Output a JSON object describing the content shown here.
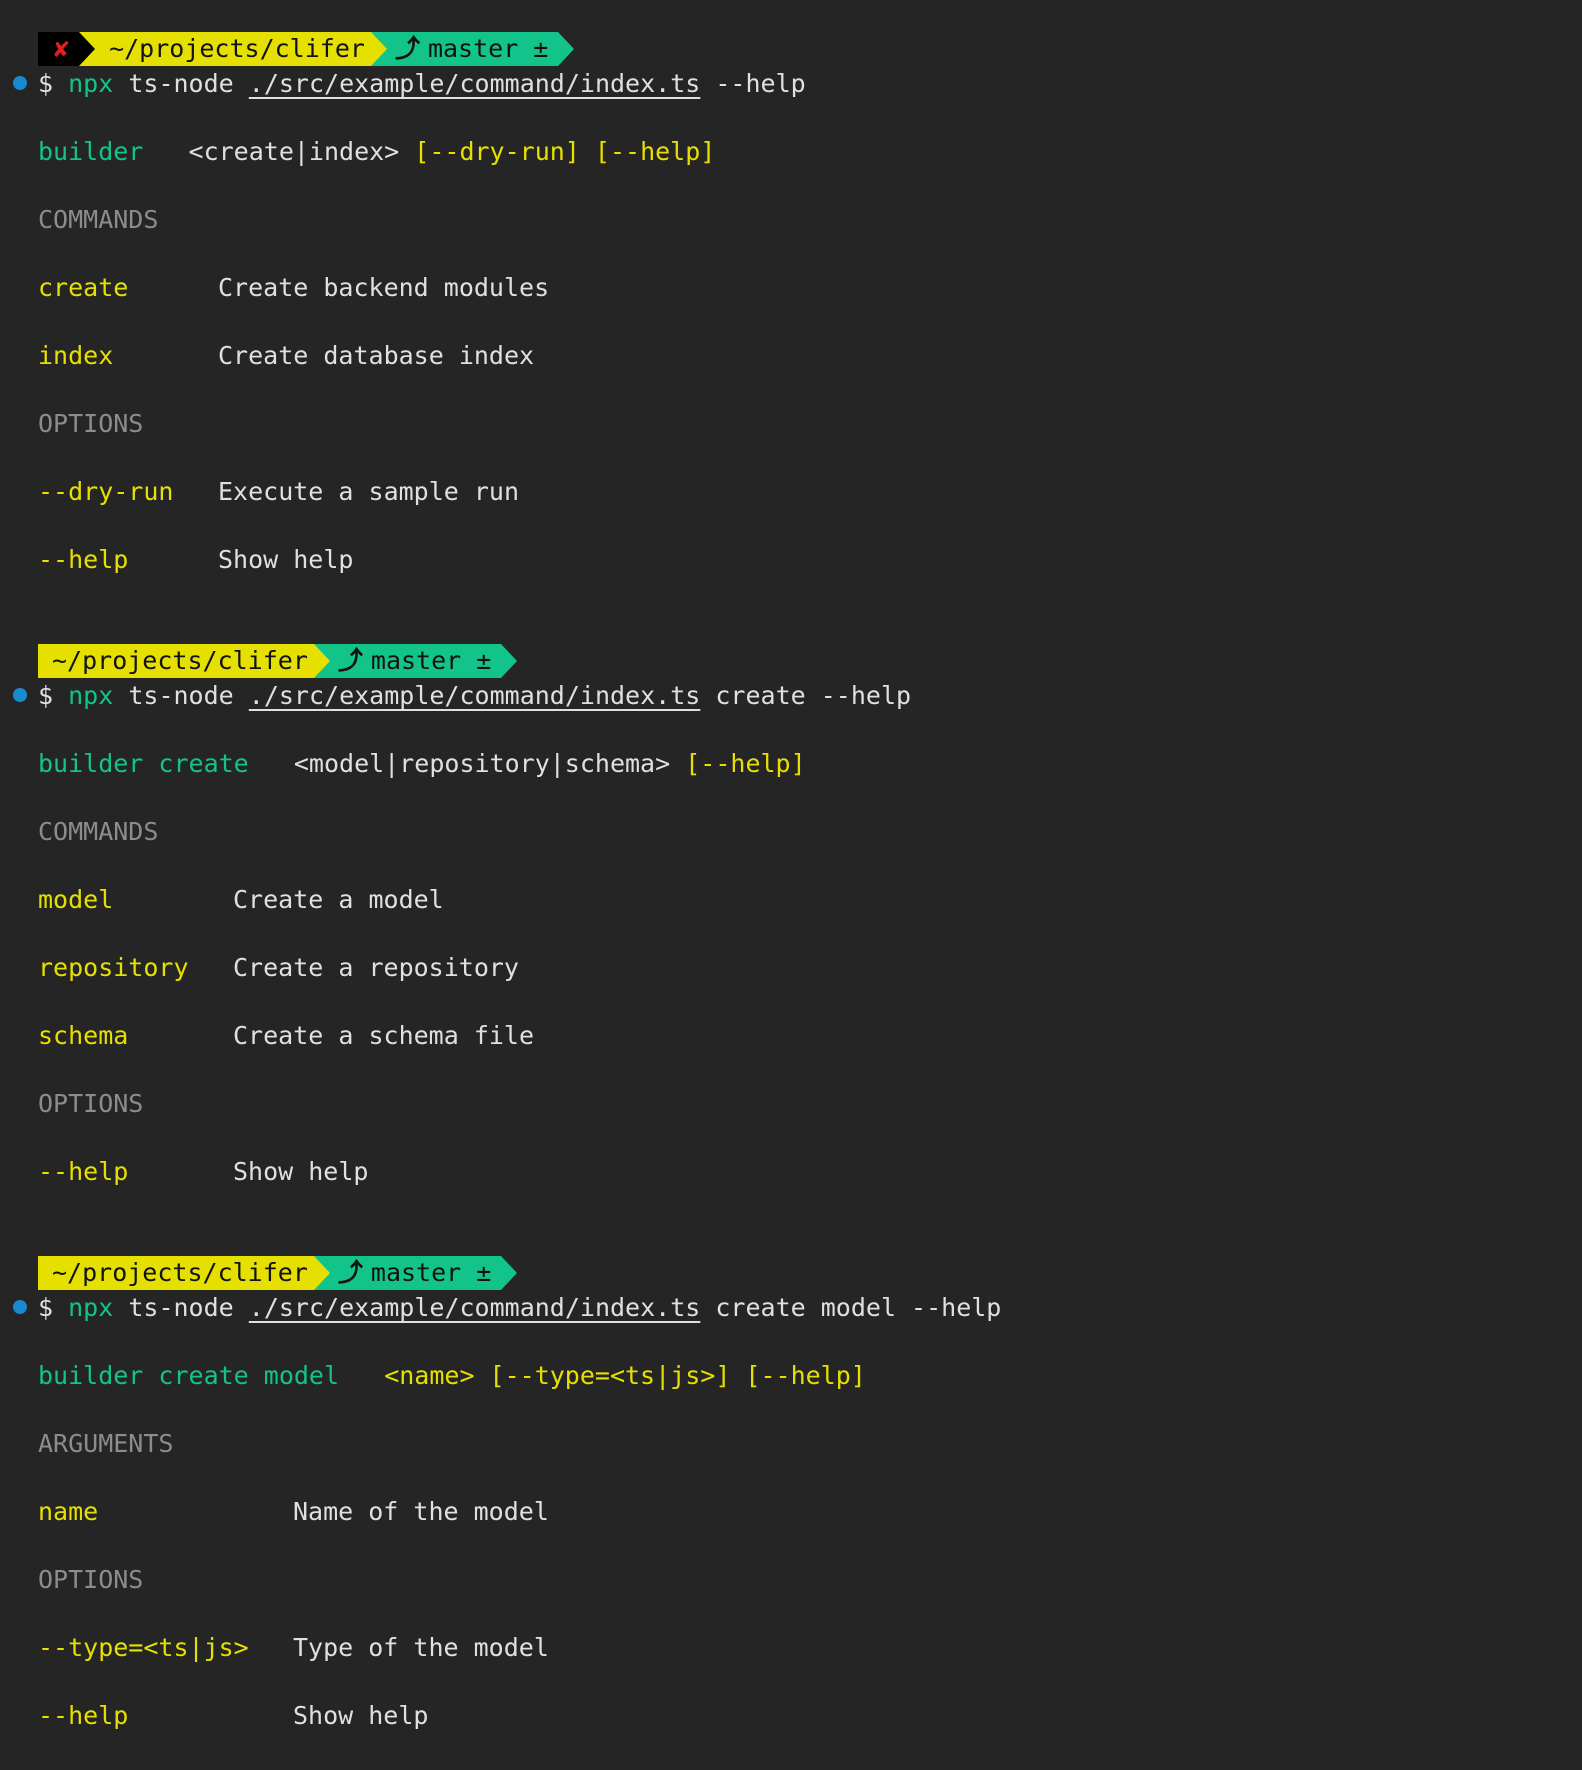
{
  "blocks": [
    {
      "prompt": {
        "error_icon": "✘",
        "path": "~/projects/clifer",
        "branch_icon": "⤴",
        "branch": "master ±"
      },
      "command": {
        "dollar": "$",
        "npx": "npx",
        "tsnode": "ts-node",
        "file": "./src/example/command/index.ts",
        "args": "--help"
      },
      "usage": {
        "name": "builder",
        "synopsis_plain": "<create|index>",
        "synopsis_options": "[--dry-run] [--help]"
      },
      "sections": [
        {
          "heading": "COMMANDS",
          "rows": [
            {
              "key": "create",
              "desc": "Create backend modules"
            },
            {
              "key": "index",
              "desc": "Create database index"
            }
          ]
        },
        {
          "heading": "OPTIONS",
          "rows": [
            {
              "key": "--dry-run",
              "desc": "Execute a sample run"
            },
            {
              "key": "--help",
              "desc": "Show help"
            }
          ]
        }
      ]
    },
    {
      "prompt": {
        "path": "~/projects/clifer",
        "branch_icon": "⤴",
        "branch": "master ±"
      },
      "command": {
        "dollar": "$",
        "npx": "npx",
        "tsnode": "ts-node",
        "file": "./src/example/command/index.ts",
        "args": "create --help"
      },
      "usage": {
        "name": "builder create",
        "synopsis_plain": "<model|repository|schema>",
        "synopsis_options": "[--help]"
      },
      "sections": [
        {
          "heading": "COMMANDS",
          "rows": [
            {
              "key": "model",
              "desc": "Create a model"
            },
            {
              "key": "repository",
              "desc": "Create a repository"
            },
            {
              "key": "schema",
              "desc": "Create a schema file"
            }
          ]
        },
        {
          "heading": "OPTIONS",
          "rows": [
            {
              "key": "--help",
              "desc": "Show help"
            }
          ]
        }
      ]
    },
    {
      "prompt": {
        "path": "~/projects/clifer",
        "branch_icon": "⤴",
        "branch": "master ±"
      },
      "command": {
        "dollar": "$",
        "npx": "npx",
        "tsnode": "ts-node",
        "file": "./src/example/command/index.ts",
        "args": "create model --help"
      },
      "usage": {
        "name": "builder create model",
        "synopsis_options": "<name> [--type=<ts|js>] [--help]"
      },
      "sections": [
        {
          "heading": "ARGUMENTS",
          "rows": [
            {
              "key": "name",
              "desc": "Name of the model"
            }
          ]
        },
        {
          "heading": "OPTIONS",
          "rows": [
            {
              "key": "--type=<ts|js>",
              "desc": "Type of the model"
            },
            {
              "key": "--help",
              "desc": "Show help"
            }
          ]
        }
      ]
    }
  ],
  "colors": {
    "background": "#252525",
    "command_key": "#e6e000",
    "program_name": "#12c48a",
    "heading": "#8c8c8c",
    "prompt_dot": "#1a8ad0"
  }
}
